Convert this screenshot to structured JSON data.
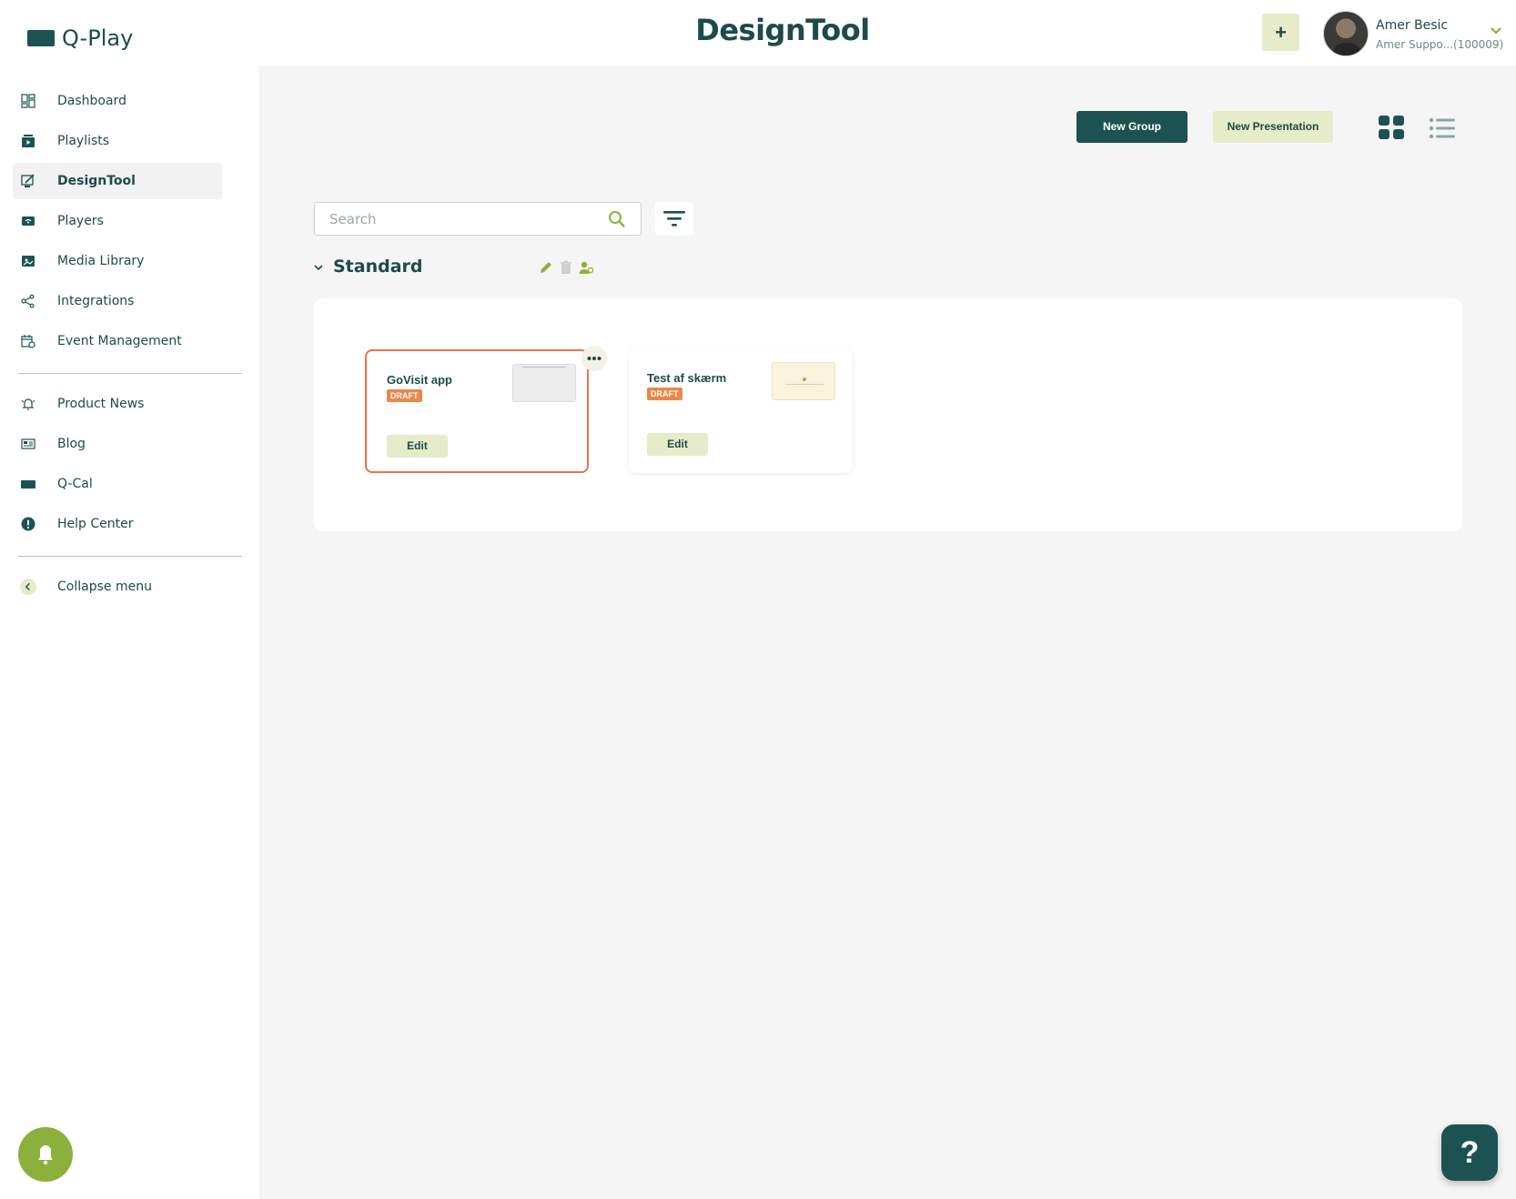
{
  "app": {
    "name": "Q-Play",
    "page_title": "DesignTool"
  },
  "header": {
    "add_label": "+"
  },
  "user": {
    "name": "Amer Besic",
    "subtitle": "Amer Suppo...(100009)"
  },
  "sidebar": {
    "primary": [
      {
        "label": "Dashboard",
        "icon": "dashboard-icon"
      },
      {
        "label": "Playlists",
        "icon": "playlists-icon"
      },
      {
        "label": "DesignTool",
        "icon": "designtool-icon",
        "active": true
      },
      {
        "label": "Players",
        "icon": "players-icon"
      },
      {
        "label": "Media Library",
        "icon": "media-library-icon"
      },
      {
        "label": "Integrations",
        "icon": "integrations-icon"
      },
      {
        "label": "Event Management",
        "icon": "event-management-icon"
      }
    ],
    "secondary": [
      {
        "label": "Product News",
        "icon": "product-news-icon"
      },
      {
        "label": "Blog",
        "icon": "blog-icon"
      },
      {
        "label": "Q-Cal",
        "icon": "q-cal-icon"
      },
      {
        "label": "Help Center",
        "icon": "help-center-icon"
      }
    ],
    "collapse_label": "Collapse menu"
  },
  "toolbar": {
    "new_group_label": "New Group",
    "new_presentation_label": "New Presentation"
  },
  "search": {
    "placeholder": "Search",
    "value": ""
  },
  "group": {
    "title": "Standard",
    "presentations": [
      {
        "title": "GoVisit app",
        "status": "DRAFT",
        "edit_label": "Edit",
        "selected": true
      },
      {
        "title": "Test af skærm",
        "status": "DRAFT",
        "edit_label": "Edit",
        "selected": false
      }
    ]
  },
  "help": {
    "label": "?"
  },
  "colors": {
    "primary": "#1d5252",
    "accent_light": "#e6ecc9",
    "accent_green": "#8cb03c",
    "draft_badge": "#e8894a",
    "selected_border": "#e8734a",
    "background": "#f5f5f5"
  }
}
